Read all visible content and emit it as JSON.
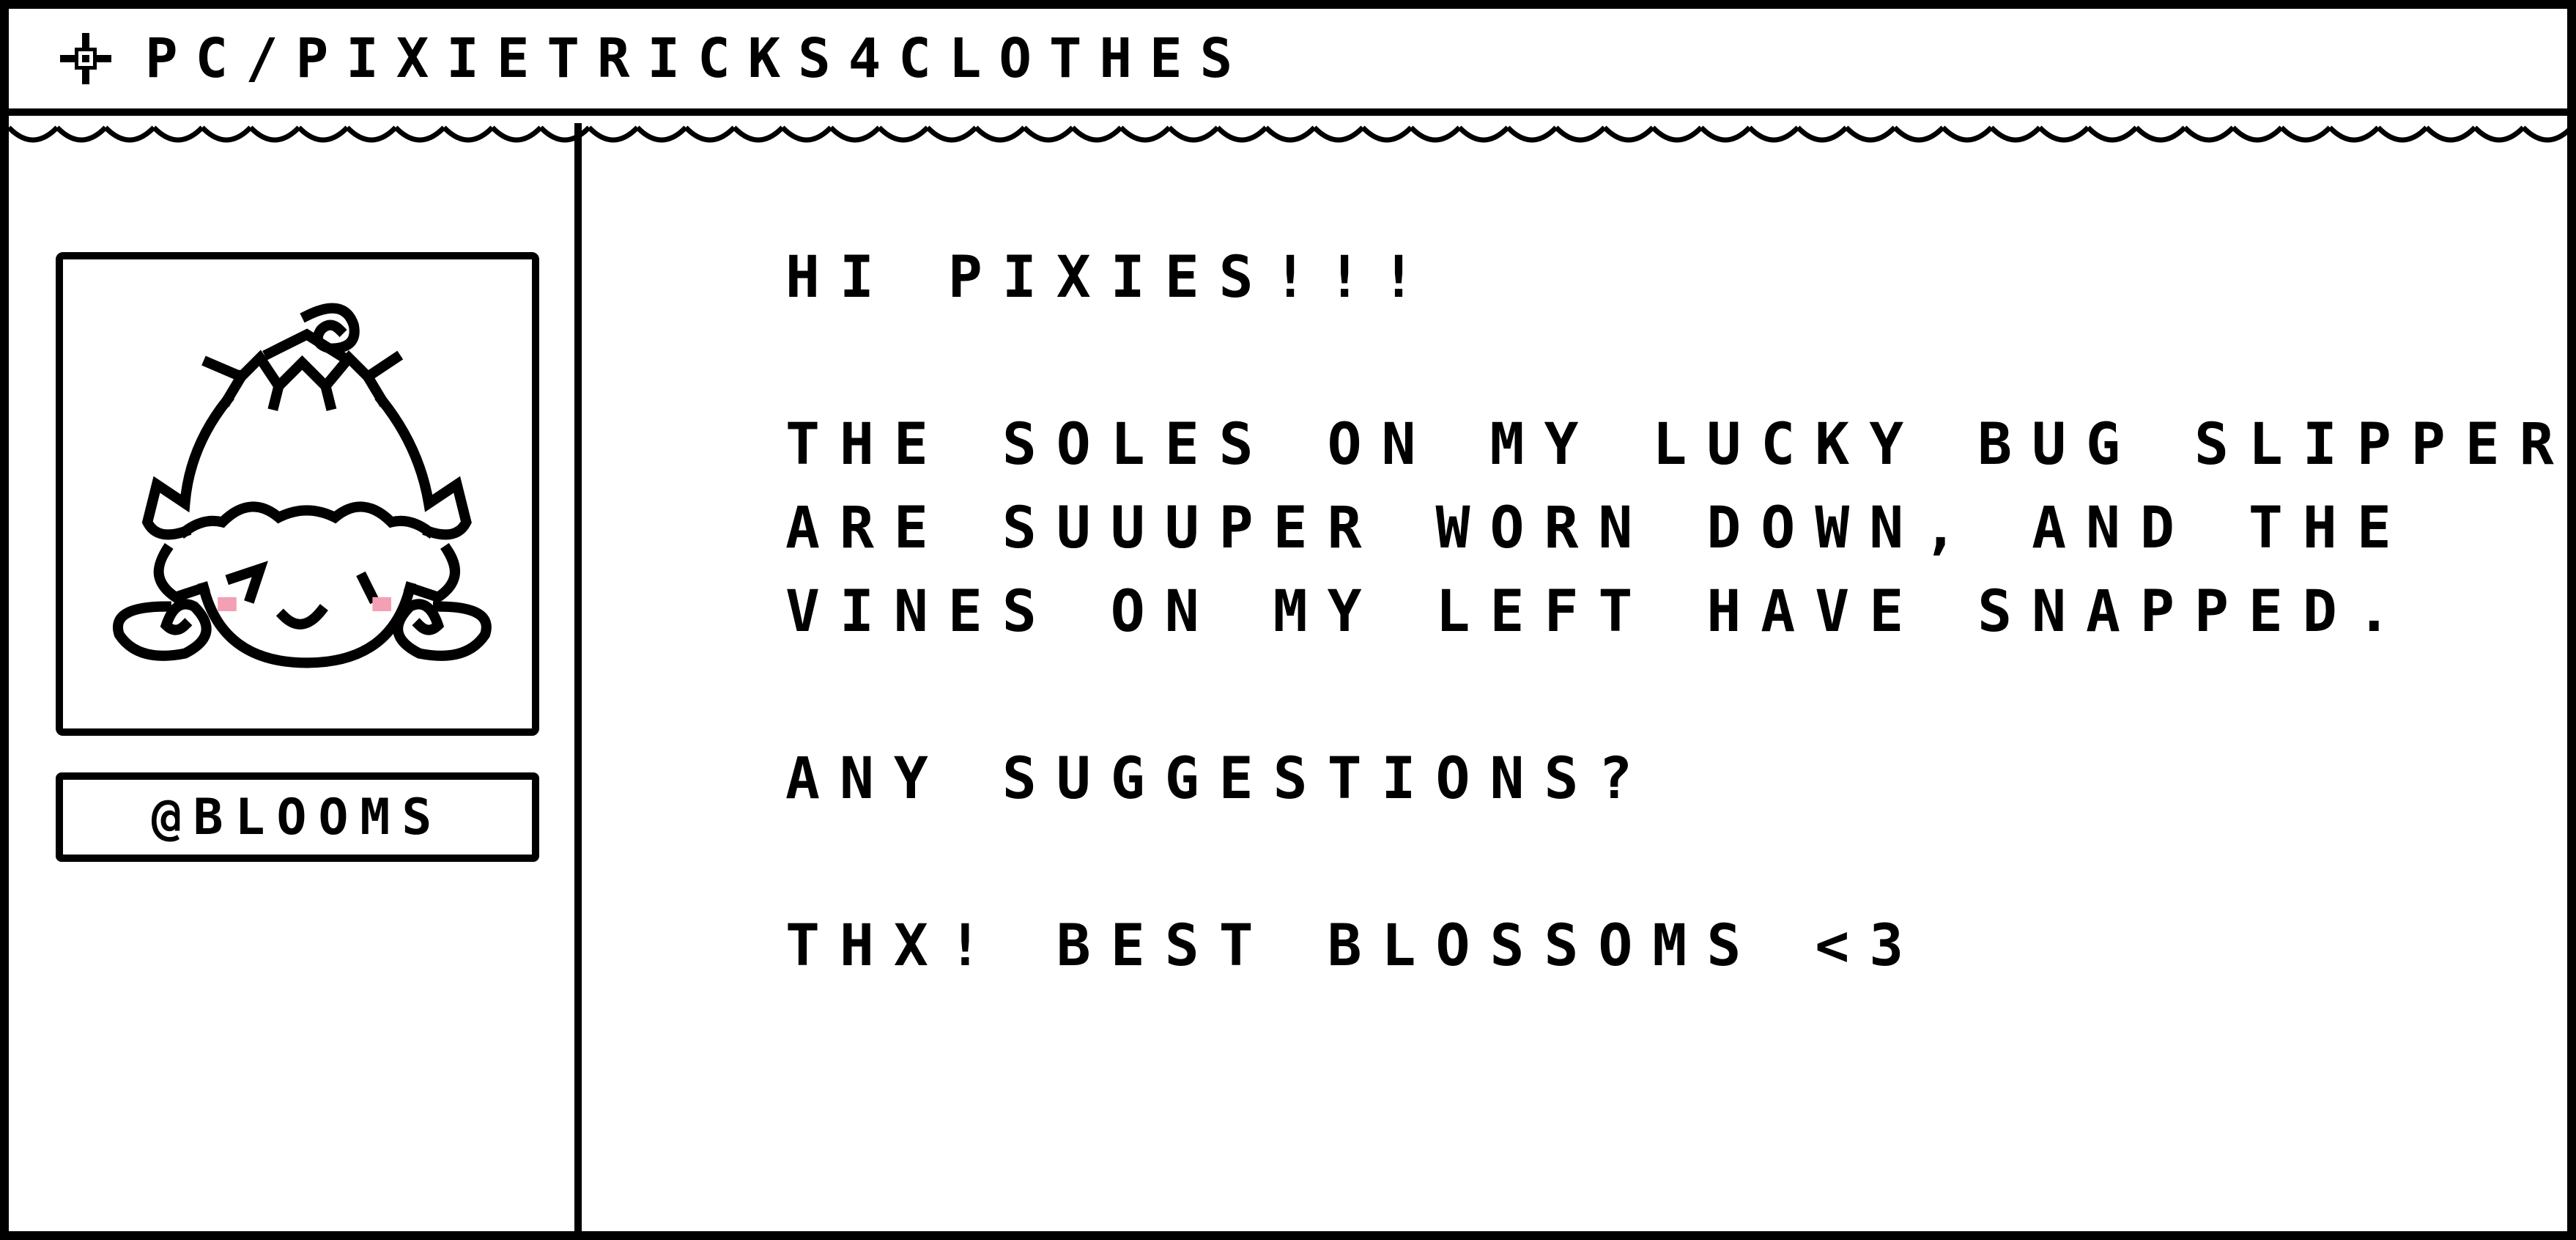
{
  "window": {
    "title": "PC/PIXIETRICKS4CLOTHES",
    "title_icon": "sparkle-icon"
  },
  "sidebar": {
    "avatar_icon": "pixie-avatar-icon",
    "handle": "@BLOOMS"
  },
  "post": {
    "greeting": "HI PIXIES!!!",
    "body_lines": [
      "THE SOLES ON MY LUCKY BUG SLIPPERS",
      "ARE SUUUPER WORN DOWN, AND THE",
      "VINES ON MY LEFT HAVE SNAPPED."
    ],
    "question": "ANY SUGGESTIONS?",
    "signoff": "THX! BEST BLOSSOMS <3"
  },
  "colors": {
    "ink": "#000000",
    "paper": "#ffffff",
    "blush": "#f4a0b4"
  }
}
